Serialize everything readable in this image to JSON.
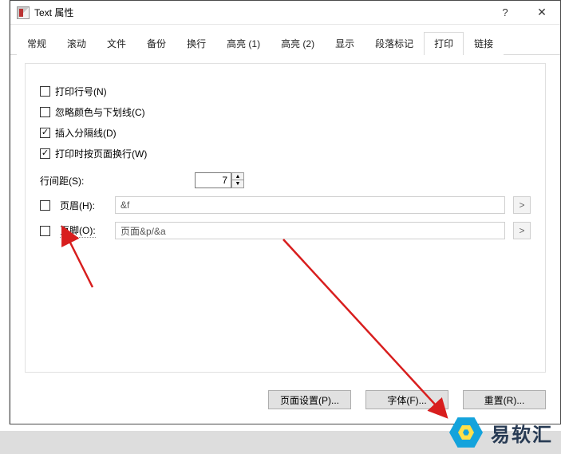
{
  "window": {
    "title": "Text 属性",
    "help_glyph": "?",
    "close_glyph": "✕"
  },
  "tabs": [
    {
      "label": "常规"
    },
    {
      "label": "滚动"
    },
    {
      "label": "文件"
    },
    {
      "label": "备份"
    },
    {
      "label": "换行"
    },
    {
      "label": "高亮 (1)"
    },
    {
      "label": "高亮 (2)"
    },
    {
      "label": "显示"
    },
    {
      "label": "段落标记"
    },
    {
      "label": "打印",
      "active": true
    },
    {
      "label": "链接"
    }
  ],
  "options": {
    "print_line_numbers": {
      "label": "打印行号(N)",
      "checked": false
    },
    "ignore_color_underline": {
      "label": "忽略颜色与下划线(C)",
      "checked": false
    },
    "insert_separator": {
      "label": "插入分隔线(D)",
      "checked": true
    },
    "wrap_by_page": {
      "label": "打印时按页面换行(W)",
      "checked": true
    }
  },
  "spacing": {
    "label": "行间距(S):",
    "value": "7"
  },
  "header": {
    "chk_label": "页眉(H):",
    "checked": false,
    "value": "&f",
    "arrow": ">"
  },
  "footer": {
    "chk_label": "页脚(O):",
    "checked": false,
    "value": "页面&p/&a",
    "arrow": ">"
  },
  "buttons": {
    "page_setup": "页面设置(P)...",
    "font": "字体(F)...",
    "reset": "重置(R)..."
  },
  "watermark": {
    "text": "易软汇"
  }
}
